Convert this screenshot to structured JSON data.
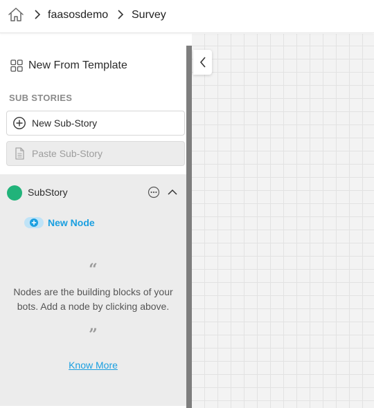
{
  "breadcrumb": {
    "home_icon": "home-icon",
    "items": [
      "faasosdemo",
      "Survey"
    ]
  },
  "sidebar": {
    "template_label": "New From Template",
    "template_icon": "grid-icon",
    "section_title": "SUB STORIES",
    "new_substory_label": "New Sub-Story",
    "paste_substory_label": "Paste Sub-Story"
  },
  "substory": {
    "name": "SubStory",
    "status_color": "#21b37a",
    "new_node_label": "New Node",
    "open_quote": "“",
    "info_line1": "Nodes are the building blocks of your",
    "info_line2": "bots. Add a node by clicking above.",
    "close_quote": "”",
    "know_more_label": "Know More"
  },
  "colors": {
    "accent": "#1a9fe0",
    "canvas_bg": "#f3f3f3",
    "panel_bg": "#ececec"
  }
}
